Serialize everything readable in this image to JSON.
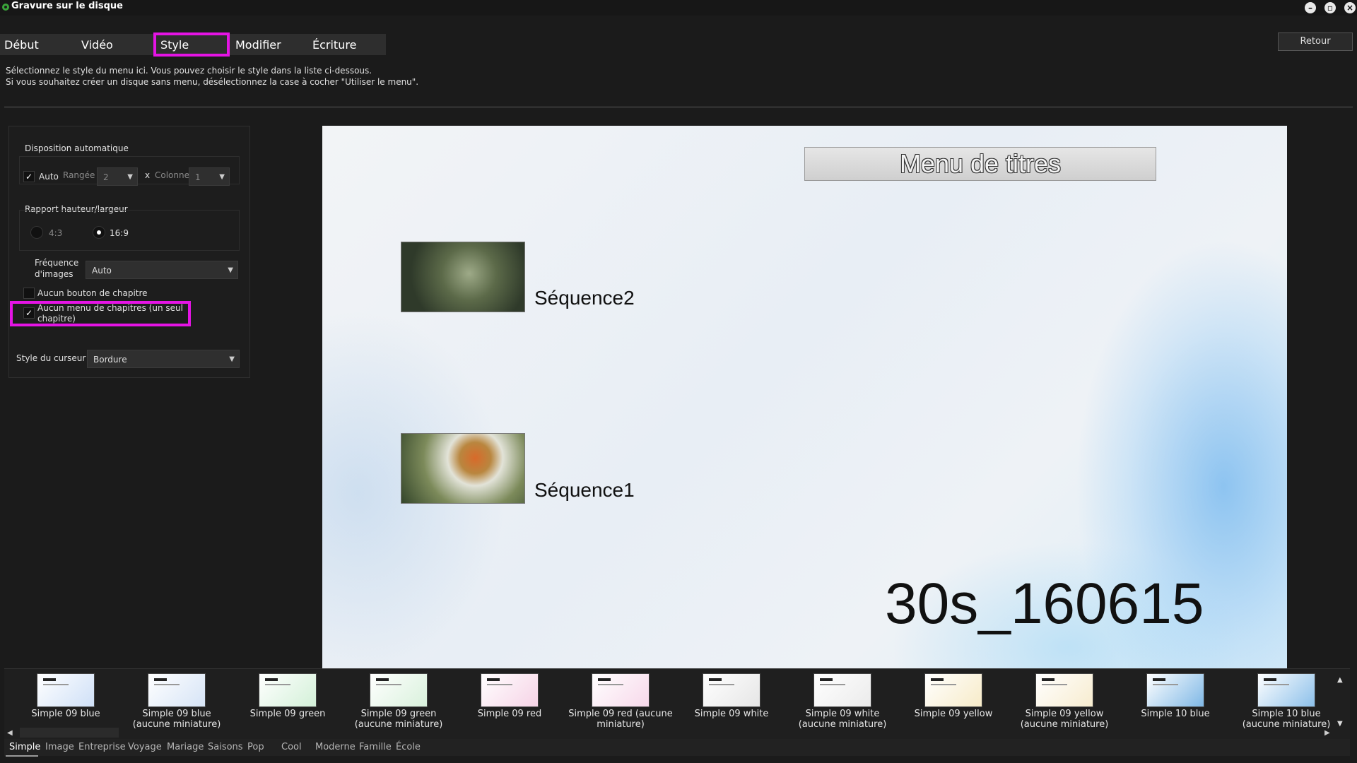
{
  "window": {
    "title": "Gravure sur le disque"
  },
  "tabs": [
    {
      "label": "Début"
    },
    {
      "label": "Vidéo"
    },
    {
      "label": "Style"
    },
    {
      "label": "Modifier"
    },
    {
      "label": "Écriture"
    }
  ],
  "active_tab": "Style",
  "back_button": "Retour",
  "instructions": {
    "line1": "Sélectionnez le style du menu ici. Vous pouvez choisir le style dans la liste ci-dessous.",
    "line2": "Si vous souhaitez créer un disque sans menu, désélectionnez la case à cocher \"Utiliser le menu\"."
  },
  "layout": {
    "group_title": "Disposition automatique",
    "auto_label": "Auto",
    "auto_checked": true,
    "row_label": "Rangée",
    "row_value": "2",
    "x_label": "x",
    "column_label": "Colonne",
    "column_value": "1"
  },
  "aspect": {
    "group_title": "Rapport hauteur/largeur",
    "option_43": "4:3",
    "option_169": "16:9",
    "selected": "16:9"
  },
  "frame_rate": {
    "label_line1": "Fréquence",
    "label_line2": "d'images",
    "value": "Auto"
  },
  "no_chapter_button": {
    "label": "Aucun bouton de chapitre",
    "checked": false
  },
  "no_chapter_menu": {
    "label": "Aucun menu de chapitres (un seul chapitre)",
    "checked": true
  },
  "cursor_style": {
    "label": "Style du curseur",
    "value": "Bordure"
  },
  "preview": {
    "menu_title": "Menu de titres",
    "sequences": [
      {
        "label": "Séquence2"
      },
      {
        "label": "Séquence1"
      }
    ],
    "disc_name": "30s_160615"
  },
  "templates": [
    {
      "name": "Simple 09 blue",
      "color": "#cfe0f7"
    },
    {
      "name": "Simple 09 blue (aucune miniature)",
      "color": "#d6e4f6"
    },
    {
      "name": "Simple 09 green",
      "color": "#d3f0d8"
    },
    {
      "name": "Simple 09 green (aucune miniature)",
      "color": "#d9f1dc"
    },
    {
      "name": "Simple 09 red",
      "color": "#f6d3e6"
    },
    {
      "name": "Simple 09 red (aucune miniature)",
      "color": "#f7d8ea"
    },
    {
      "name": "Simple 09 white",
      "color": "#e6e6e6"
    },
    {
      "name": "Simple 09 white (aucune miniature)",
      "color": "#ebebeb"
    },
    {
      "name": "Simple 09 yellow",
      "color": "#f7ebc8"
    },
    {
      "name": "Simple 09 yellow (aucune miniature)",
      "color": "#f7eccf"
    },
    {
      "name": "Simple 10 blue",
      "color": "#7fb8e6"
    },
    {
      "name": "Simple 10 blue (aucune miniature)",
      "color": "#8cc0ea"
    }
  ],
  "categories": [
    {
      "label": "Simple"
    },
    {
      "label": "Image"
    },
    {
      "label": "Entreprise"
    },
    {
      "label": "Voyage"
    },
    {
      "label": "Mariage"
    },
    {
      "label": "Saisons"
    },
    {
      "label": "Pop"
    },
    {
      "label": "Cool"
    },
    {
      "label": "Moderne"
    },
    {
      "label": "Famille"
    },
    {
      "label": "École"
    }
  ],
  "active_category": "Simple",
  "colors": {
    "highlight": "#e514e5",
    "background": "#1b1b1b"
  }
}
